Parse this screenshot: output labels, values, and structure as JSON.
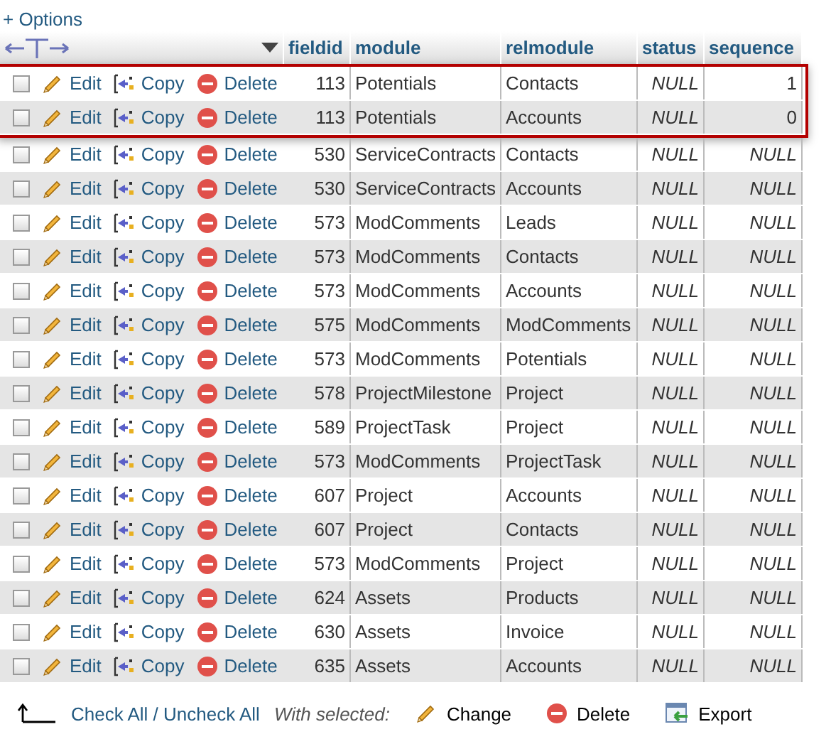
{
  "options_link": "+ Options",
  "columns": [
    "fieldid",
    "module",
    "relmodule",
    "status",
    "sequence"
  ],
  "rows": [
    {
      "checked": false,
      "marked": true,
      "actions": [
        "Edit",
        "Copy",
        "Delete"
      ],
      "fieldid": "113",
      "module": "Potentials",
      "relmodule": "Contacts",
      "status": {
        "value": "NULL",
        "is_null": true
      },
      "sequence": {
        "value": "1",
        "is_null": false
      }
    },
    {
      "checked": false,
      "marked": true,
      "actions": [
        "Edit",
        "Copy",
        "Delete"
      ],
      "fieldid": "113",
      "module": "Potentials",
      "relmodule": "Accounts",
      "status": {
        "value": "NULL",
        "is_null": true
      },
      "sequence": {
        "value": "0",
        "is_null": false
      }
    },
    {
      "checked": false,
      "marked": false,
      "actions": [
        "Edit",
        "Copy",
        "Delete"
      ],
      "fieldid": "530",
      "module": "ServiceContracts",
      "relmodule": "Contacts",
      "status": {
        "value": "NULL",
        "is_null": true
      },
      "sequence": {
        "value": "NULL",
        "is_null": true
      }
    },
    {
      "checked": false,
      "marked": false,
      "actions": [
        "Edit",
        "Copy",
        "Delete"
      ],
      "fieldid": "530",
      "module": "ServiceContracts",
      "relmodule": "Accounts",
      "status": {
        "value": "NULL",
        "is_null": true
      },
      "sequence": {
        "value": "NULL",
        "is_null": true
      }
    },
    {
      "checked": false,
      "marked": false,
      "actions": [
        "Edit",
        "Copy",
        "Delete"
      ],
      "fieldid": "573",
      "module": "ModComments",
      "relmodule": "Leads",
      "status": {
        "value": "NULL",
        "is_null": true
      },
      "sequence": {
        "value": "NULL",
        "is_null": true
      }
    },
    {
      "checked": false,
      "marked": false,
      "actions": [
        "Edit",
        "Copy",
        "Delete"
      ],
      "fieldid": "573",
      "module": "ModComments",
      "relmodule": "Contacts",
      "status": {
        "value": "NULL",
        "is_null": true
      },
      "sequence": {
        "value": "NULL",
        "is_null": true
      }
    },
    {
      "checked": false,
      "marked": false,
      "actions": [
        "Edit",
        "Copy",
        "Delete"
      ],
      "fieldid": "573",
      "module": "ModComments",
      "relmodule": "Accounts",
      "status": {
        "value": "NULL",
        "is_null": true
      },
      "sequence": {
        "value": "NULL",
        "is_null": true
      }
    },
    {
      "checked": false,
      "marked": false,
      "actions": [
        "Edit",
        "Copy",
        "Delete"
      ],
      "fieldid": "575",
      "module": "ModComments",
      "relmodule": "ModComments",
      "status": {
        "value": "NULL",
        "is_null": true
      },
      "sequence": {
        "value": "NULL",
        "is_null": true
      }
    },
    {
      "checked": false,
      "marked": false,
      "actions": [
        "Edit",
        "Copy",
        "Delete"
      ],
      "fieldid": "573",
      "module": "ModComments",
      "relmodule": "Potentials",
      "status": {
        "value": "NULL",
        "is_null": true
      },
      "sequence": {
        "value": "NULL",
        "is_null": true
      }
    },
    {
      "checked": false,
      "marked": false,
      "actions": [
        "Edit",
        "Copy",
        "Delete"
      ],
      "fieldid": "578",
      "module": "ProjectMilestone",
      "relmodule": "Project",
      "status": {
        "value": "NULL",
        "is_null": true
      },
      "sequence": {
        "value": "NULL",
        "is_null": true
      }
    },
    {
      "checked": false,
      "marked": false,
      "actions": [
        "Edit",
        "Copy",
        "Delete"
      ],
      "fieldid": "589",
      "module": "ProjectTask",
      "relmodule": "Project",
      "status": {
        "value": "NULL",
        "is_null": true
      },
      "sequence": {
        "value": "NULL",
        "is_null": true
      }
    },
    {
      "checked": false,
      "marked": false,
      "actions": [
        "Edit",
        "Copy",
        "Delete"
      ],
      "fieldid": "573",
      "module": "ModComments",
      "relmodule": "ProjectTask",
      "status": {
        "value": "NULL",
        "is_null": true
      },
      "sequence": {
        "value": "NULL",
        "is_null": true
      }
    },
    {
      "checked": false,
      "marked": false,
      "actions": [
        "Edit",
        "Copy",
        "Delete"
      ],
      "fieldid": "607",
      "module": "Project",
      "relmodule": "Accounts",
      "status": {
        "value": "NULL",
        "is_null": true
      },
      "sequence": {
        "value": "NULL",
        "is_null": true
      }
    },
    {
      "checked": false,
      "marked": false,
      "actions": [
        "Edit",
        "Copy",
        "Delete"
      ],
      "fieldid": "607",
      "module": "Project",
      "relmodule": "Contacts",
      "status": {
        "value": "NULL",
        "is_null": true
      },
      "sequence": {
        "value": "NULL",
        "is_null": true
      }
    },
    {
      "checked": false,
      "marked": false,
      "actions": [
        "Edit",
        "Copy",
        "Delete"
      ],
      "fieldid": "573",
      "module": "ModComments",
      "relmodule": "Project",
      "status": {
        "value": "NULL",
        "is_null": true
      },
      "sequence": {
        "value": "NULL",
        "is_null": true
      }
    },
    {
      "checked": false,
      "marked": false,
      "actions": [
        "Edit",
        "Copy",
        "Delete"
      ],
      "fieldid": "624",
      "module": "Assets",
      "relmodule": "Products",
      "status": {
        "value": "NULL",
        "is_null": true
      },
      "sequence": {
        "value": "NULL",
        "is_null": true
      }
    },
    {
      "checked": false,
      "marked": false,
      "actions": [
        "Edit",
        "Copy",
        "Delete"
      ],
      "fieldid": "630",
      "module": "Assets",
      "relmodule": "Invoice",
      "status": {
        "value": "NULL",
        "is_null": true
      },
      "sequence": {
        "value": "NULL",
        "is_null": true
      }
    },
    {
      "checked": false,
      "marked": false,
      "actions": [
        "Edit",
        "Copy",
        "Delete"
      ],
      "fieldid": "635",
      "module": "Assets",
      "relmodule": "Accounts",
      "status": {
        "value": "NULL",
        "is_null": true
      },
      "sequence": {
        "value": "NULL",
        "is_null": true
      }
    }
  ],
  "footer": {
    "check_all": "Check All / Uncheck All",
    "with_selected": "With selected:",
    "actions": [
      {
        "kind": "change",
        "label": "Change"
      },
      {
        "kind": "delete",
        "label": "Delete"
      },
      {
        "kind": "export",
        "label": "Export"
      }
    ]
  }
}
